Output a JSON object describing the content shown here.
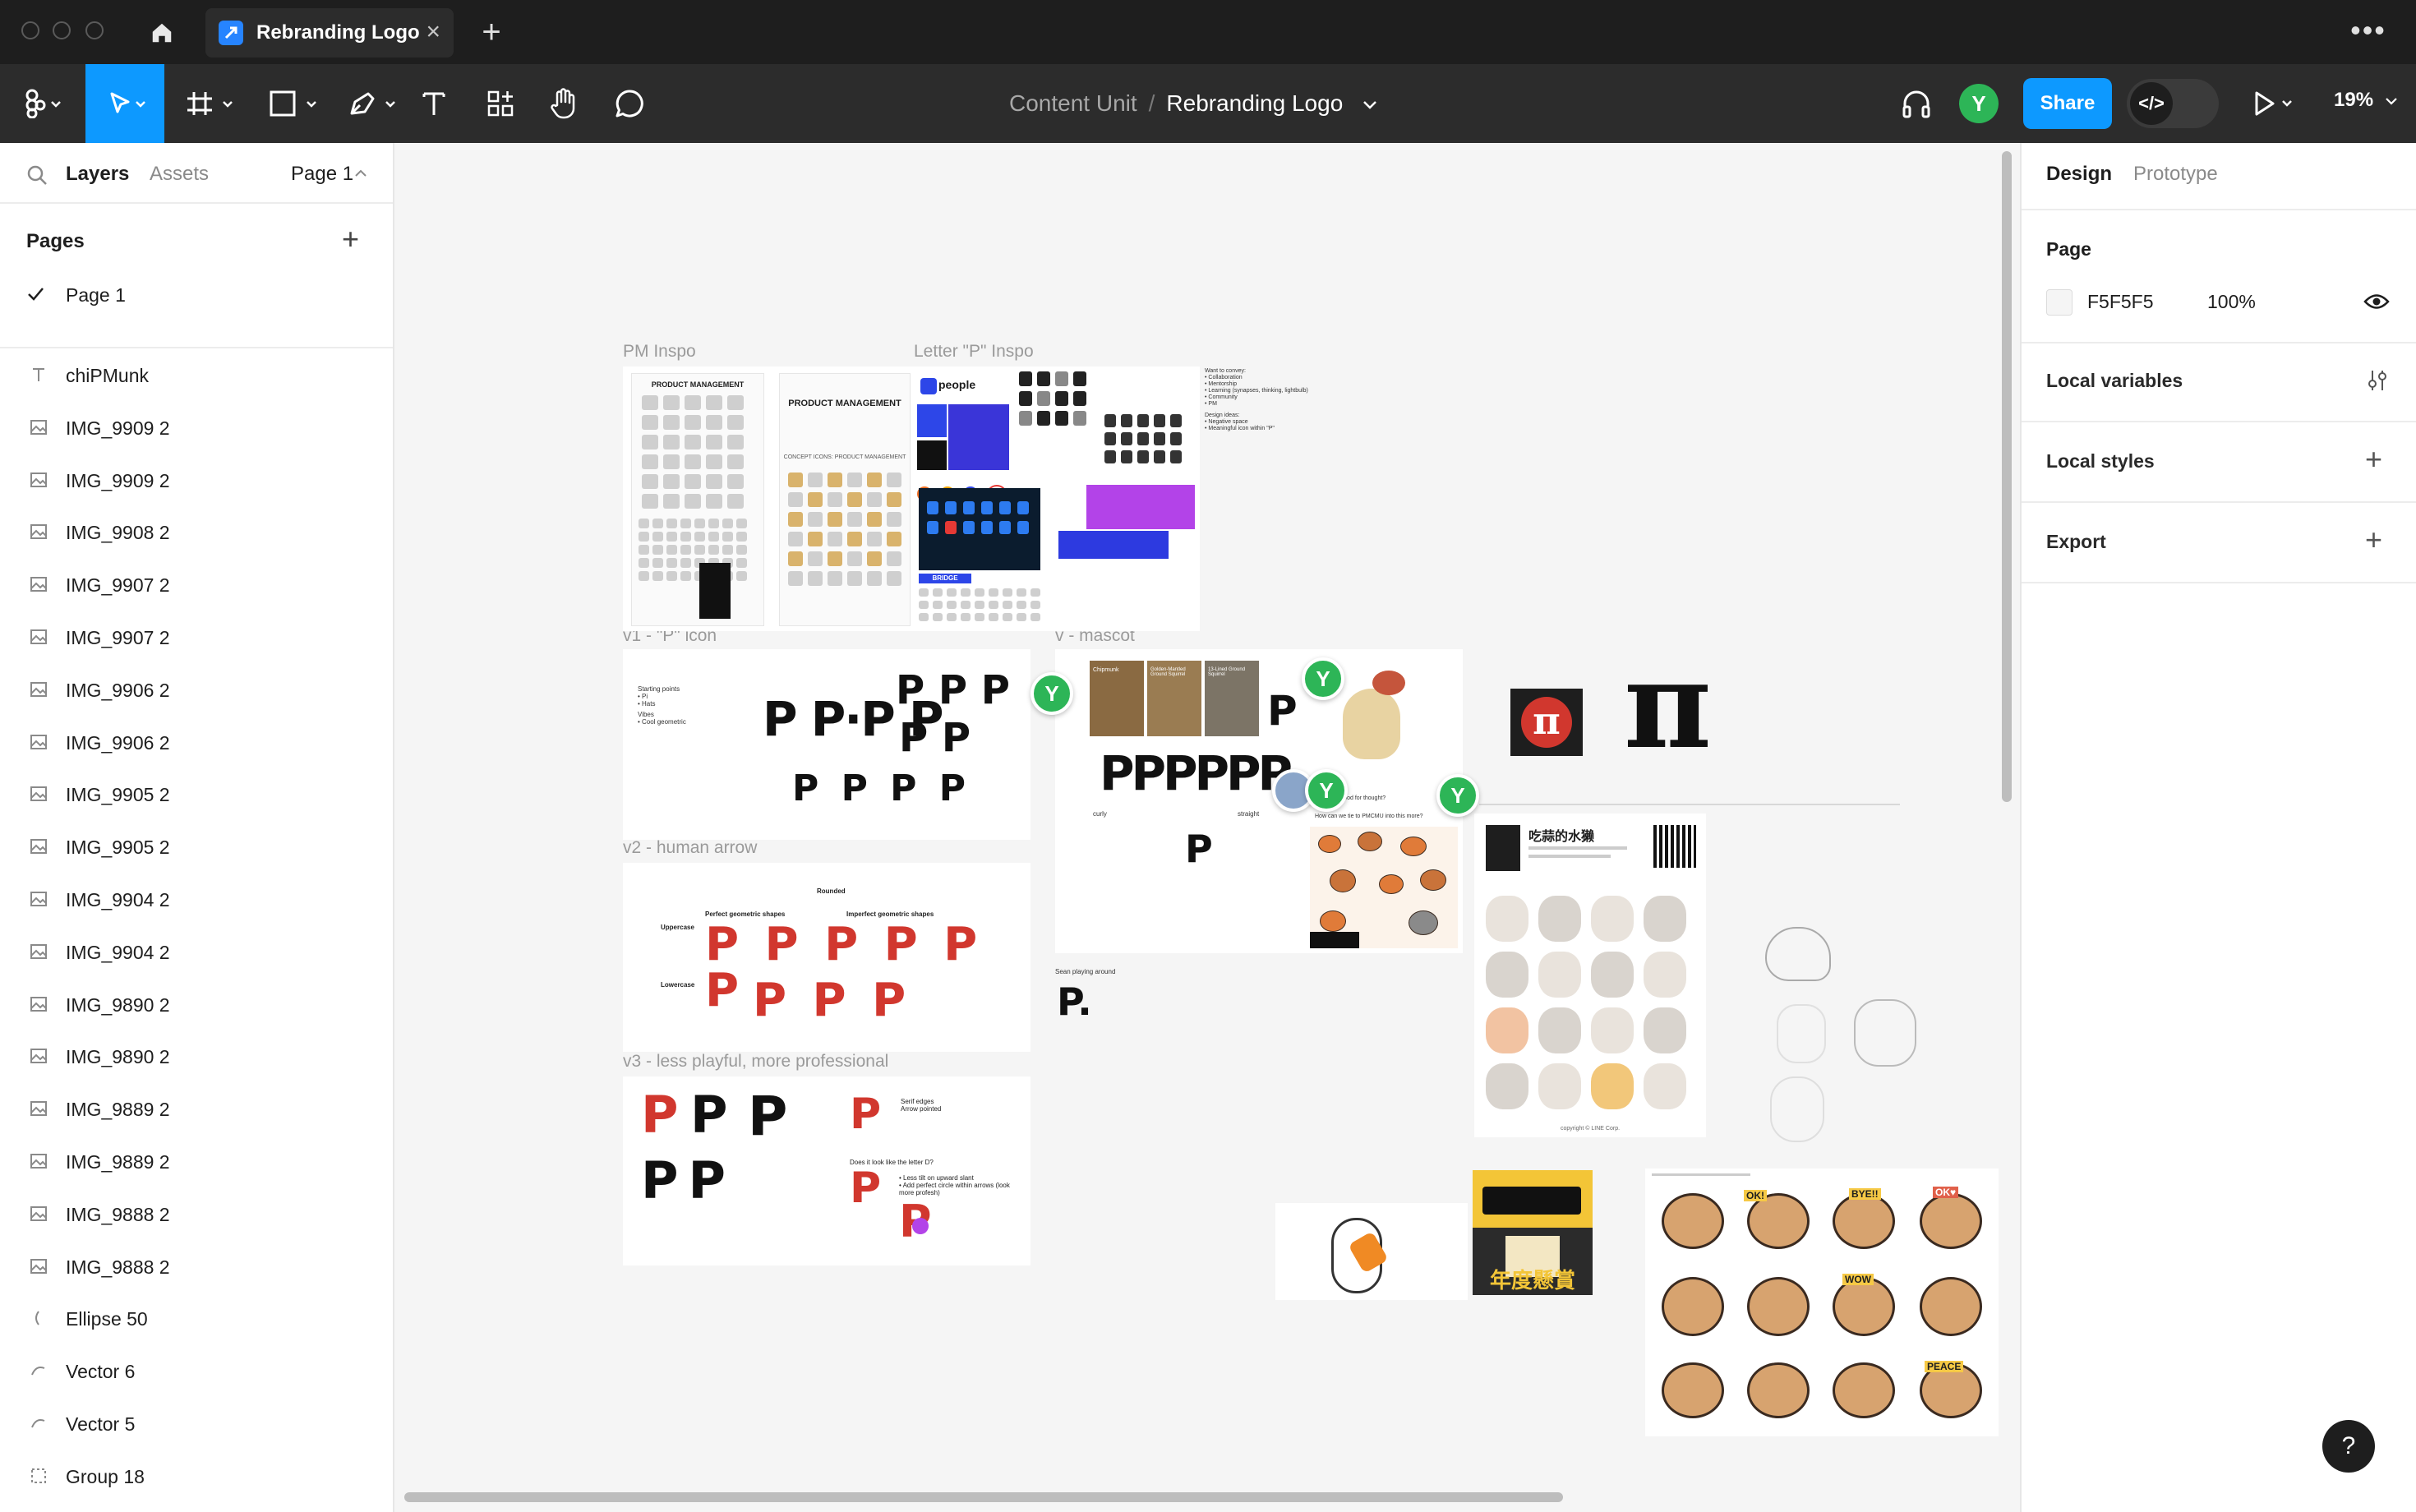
{
  "window": {
    "tab_title": "Rebranding Logo",
    "new_tab": "+",
    "more": "•••"
  },
  "toolbar": {
    "breadcrumb_project": "Content Unit",
    "breadcrumb_separator": "/",
    "breadcrumb_file": "Rebranding Logo",
    "user_initial": "Y",
    "share_label": "Share",
    "zoom_label": "19%",
    "dev_mode_icon": "</>"
  },
  "left_panel": {
    "tabs": {
      "layers": "Layers",
      "assets": "Assets",
      "page_select": "Page 1"
    },
    "pages_heading": "Pages",
    "add_page": "+",
    "pages": [
      {
        "name": "Page 1",
        "selected": true
      }
    ],
    "layers": [
      {
        "name": "chiPMunk",
        "icon": "text-icon"
      },
      {
        "name": "IMG_9909 2",
        "icon": "image-icon"
      },
      {
        "name": "IMG_9909 2",
        "icon": "image-icon"
      },
      {
        "name": "IMG_9908 2",
        "icon": "image-icon"
      },
      {
        "name": "IMG_9907 2",
        "icon": "image-icon"
      },
      {
        "name": "IMG_9907 2",
        "icon": "image-icon"
      },
      {
        "name": "IMG_9906 2",
        "icon": "image-icon"
      },
      {
        "name": "IMG_9906 2",
        "icon": "image-icon"
      },
      {
        "name": "IMG_9905 2",
        "icon": "image-icon"
      },
      {
        "name": "IMG_9905 2",
        "icon": "image-icon"
      },
      {
        "name": "IMG_9904 2",
        "icon": "image-icon"
      },
      {
        "name": "IMG_9904 2",
        "icon": "image-icon"
      },
      {
        "name": "IMG_9890 2",
        "icon": "image-icon"
      },
      {
        "name": "IMG_9890 2",
        "icon": "image-icon"
      },
      {
        "name": "IMG_9889 2",
        "icon": "image-icon"
      },
      {
        "name": "IMG_9889 2",
        "icon": "image-icon"
      },
      {
        "name": "IMG_9888 2",
        "icon": "image-icon"
      },
      {
        "name": "IMG_9888 2",
        "icon": "image-icon"
      },
      {
        "name": "Ellipse 50",
        "icon": "ellipse-icon"
      },
      {
        "name": "Vector 6",
        "icon": "vector-icon"
      },
      {
        "name": "Vector 5",
        "icon": "vector-icon"
      },
      {
        "name": "Group 18",
        "icon": "group-icon"
      }
    ]
  },
  "right_panel": {
    "tabs": {
      "design": "Design",
      "prototype": "Prototype"
    },
    "page_heading": "Page",
    "page_color": "F5F5F5",
    "page_opacity": "100%",
    "local_variables": "Local variables",
    "local_styles": "Local styles",
    "export": "Export",
    "add": "+"
  },
  "canvas": {
    "frame_labels": {
      "pm_inspo": "PM Inspo",
      "letter_p_inspo": "Letter \"P\" Inspo",
      "v1": "v1 - \"P\" icon",
      "v_mascot": "v - mascot",
      "v2": "v2 - human arrow",
      "v3": "v3 - less playful, more professional"
    },
    "pm_card_1": "PRODUCT MANAGEMENT",
    "pm_card_2": "PRODUCT MANAGEMENT",
    "pm_card_2_sub": "CONCEPT ICONS: PRODUCT MANAGEMENT",
    "letterp_brand": "people",
    "letterp_bridge": "BRIDGE",
    "letterp_notes": [
      "Want to convey:",
      "• Collaboration",
      "• Mentorship",
      "• Learning (synapses, thinking, lightbulb)",
      "• Community",
      "• PM",
      "Design ideas:",
      "• Negative space",
      "• Meaningful icon within \"P\""
    ],
    "v1_notes": [
      "Starting points",
      "• Pi",
      "• Hats",
      "Vibes",
      "• Cool geometric"
    ],
    "v2": {
      "rounded": "Rounded",
      "perfect": "Perfect geometric shapes",
      "imperfect": "Imperfect geometric shapes",
      "uppercase": "Uppercase",
      "lowercase": "Lowercase"
    },
    "v3_notes": [
      "Serif edges",
      "Arrow pointed",
      "Does it look like the letter D?",
      "• Less tilt on upward slant",
      "• Add perfect circle within arrows (look more profesh)"
    ],
    "mascot": {
      "photo_1": "Chipmunk",
      "photo_2": "Golden-Mantled Ground Squirrel",
      "photo_3": "13-Lined Ground Squirrel",
      "curly": "curly",
      "straight": "straight",
      "question": "How can we tie to PMCMU into this more?",
      "process": "Just see in procreate Food for thought?",
      "playing": "Sean playing around"
    },
    "sticker_sheet": {
      "title": "吃蒜的水獭",
      "footer": "copyright © LINE Corp."
    },
    "banner_text": "年度懸賞",
    "otter_sheet_words": [
      "OK!",
      "BYE!!",
      "OK♥",
      "WOW",
      "PEACE"
    ],
    "pi_glyph": "π",
    "cursor_initial": "Y"
  },
  "help": "?"
}
